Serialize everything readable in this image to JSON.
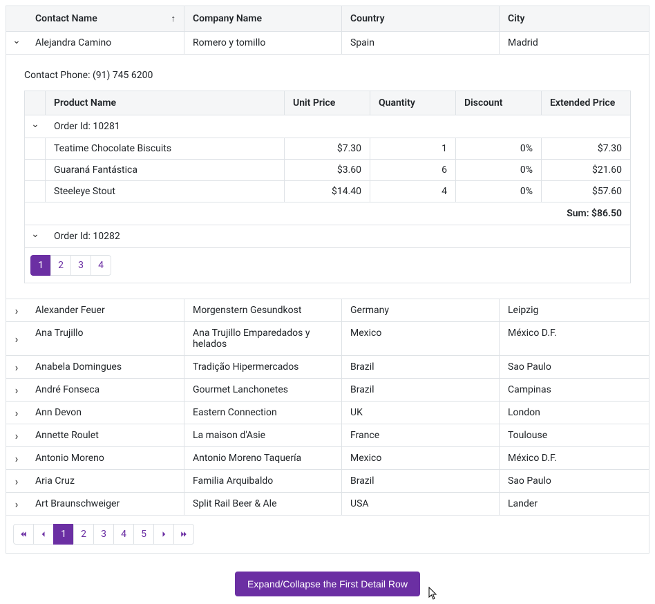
{
  "columns": {
    "contact": "Contact Name",
    "company": "Company Name",
    "country": "Country",
    "city": "City"
  },
  "rows": {
    "r0": {
      "contact": "Alejandra Camino",
      "company": "Romero y tomillo",
      "country": "Spain",
      "city": "Madrid"
    },
    "r1": {
      "contact": "Alexander Feuer",
      "company": "Morgenstern Gesundkost",
      "country": "Germany",
      "city": "Leipzig"
    },
    "r2": {
      "contact": "Ana Trujillo",
      "company": "Ana Trujillo Emparedados y helados",
      "country": "Mexico",
      "city": "México D.F."
    },
    "r3": {
      "contact": "Anabela Domingues",
      "company": "Tradição Hipermercados",
      "country": "Brazil",
      "city": "Sao Paulo"
    },
    "r4": {
      "contact": "André Fonseca",
      "company": "Gourmet Lanchonetes",
      "country": "Brazil",
      "city": "Campinas"
    },
    "r5": {
      "contact": "Ann Devon",
      "company": "Eastern Connection",
      "country": "UK",
      "city": "London"
    },
    "r6": {
      "contact": "Annette Roulet",
      "company": "La maison d'Asie",
      "country": "France",
      "city": "Toulouse"
    },
    "r7": {
      "contact": "Antonio Moreno",
      "company": "Antonio Moreno Taquería",
      "country": "Mexico",
      "city": "México D.F."
    },
    "r8": {
      "contact": "Aria Cruz",
      "company": "Familia Arquibaldo",
      "country": "Brazil",
      "city": "Sao Paulo"
    },
    "r9": {
      "contact": "Art Braunschweiger",
      "company": "Split Rail Beer & Ale",
      "country": "USA",
      "city": "Lander"
    }
  },
  "detail": {
    "phone_label": "Contact Phone: (91) 745 6200",
    "columns": {
      "product": "Product Name",
      "unit_price": "Unit Price",
      "quantity": "Quantity",
      "discount": "Discount",
      "extended": "Extended Price"
    },
    "group1": "Order Id: 10281",
    "group2": "Order Id: 10282",
    "items": {
      "i0": {
        "product": "Teatime Chocolate Biscuits",
        "unit_price": "$7.30",
        "quantity": "1",
        "discount": "0%",
        "extended": "$7.30"
      },
      "i1": {
        "product": "Guaraná Fantástica",
        "unit_price": "$3.60",
        "quantity": "6",
        "discount": "0%",
        "extended": "$21.60"
      },
      "i2": {
        "product": "Steeleye Stout",
        "unit_price": "$14.40",
        "quantity": "4",
        "discount": "0%",
        "extended": "$57.60"
      }
    },
    "sum": "Sum: $86.50",
    "pages": {
      "p1": "1",
      "p2": "2",
      "p3": "3",
      "p4": "4"
    }
  },
  "outer_pages": {
    "p1": "1",
    "p2": "2",
    "p3": "3",
    "p4": "4",
    "p5": "5"
  },
  "action_button": "Expand/Collapse the First Detail Row",
  "sort_arrow": "↑"
}
